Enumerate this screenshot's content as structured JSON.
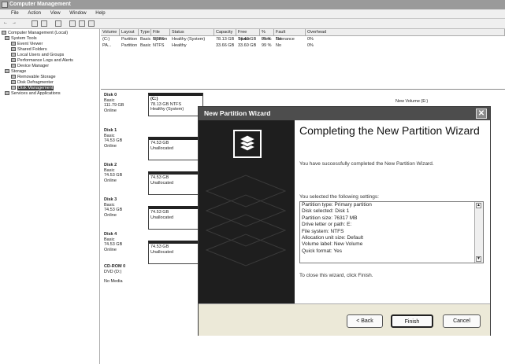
{
  "window": {
    "title": "Computer Management"
  },
  "menu": [
    "File",
    "Action",
    "View",
    "Window",
    "Help"
  ],
  "tree": [
    {
      "label": "Computer Management (Local)",
      "indent": 0
    },
    {
      "label": "System Tools",
      "indent": 1
    },
    {
      "label": "Event Viewer",
      "indent": 2
    },
    {
      "label": "Shared Folders",
      "indent": 2
    },
    {
      "label": "Local Users and Groups",
      "indent": 2
    },
    {
      "label": "Performance Logs and Alerts",
      "indent": 2
    },
    {
      "label": "Device Manager",
      "indent": 2
    },
    {
      "label": "Storage",
      "indent": 1
    },
    {
      "label": "Removable Storage",
      "indent": 2
    },
    {
      "label": "Disk Defragmenter",
      "indent": 2
    },
    {
      "label": "Disk Management",
      "indent": 2,
      "selected": true
    },
    {
      "label": "Services and Applications",
      "indent": 1
    }
  ],
  "volumes": {
    "headers": [
      "Volume",
      "Layout",
      "Type",
      "File System",
      "Status",
      "Capacity",
      "Free Space",
      "% Free",
      "Fault Tolerance",
      "Overhead"
    ],
    "rows": [
      [
        "(C:)",
        "Partition",
        "Basic",
        "NTFS",
        "Healthy (System)",
        "78.13 GB",
        "74.48 GB",
        "95 %",
        "No",
        "0%"
      ],
      [
        "PA...",
        "Partition",
        "Basic",
        "NTFS",
        "Healthy",
        "33.66 GB",
        "33.60 GB",
        "99 %",
        "No",
        "0%"
      ]
    ]
  },
  "disks": [
    {
      "name": "Disk 0",
      "type": "Basic",
      "size": "111.79 GB",
      "status": "Online",
      "part_title": "(C:)",
      "part_line1": "78.13 GB NTFS",
      "part_line2": "Healthy (System)"
    },
    {
      "name": "Disk 1",
      "type": "Basic",
      "size": "74.53 GB",
      "status": "Online",
      "part_title": "",
      "part_line1": "74.53 GB",
      "part_line2": "Unallocated"
    },
    {
      "name": "Disk 2",
      "type": "Basic",
      "size": "74.53 GB",
      "status": "Online",
      "part_title": "",
      "part_line1": "74.53 GB",
      "part_line2": "Unallocated"
    },
    {
      "name": "Disk 3",
      "type": "Basic",
      "size": "74.53 GB",
      "status": "Online",
      "part_title": "",
      "part_line1": "74.53 GB",
      "part_line2": "Unallocated"
    },
    {
      "name": "Disk 4",
      "type": "Basic",
      "size": "74.53 GB",
      "status": "Online",
      "part_title": "",
      "part_line1": "74.53 GB",
      "part_line2": "Unallocated"
    }
  ],
  "cdrom": {
    "name": "CD-ROM 0",
    "type": "DVD (D:)",
    "status": "No Media"
  },
  "disk0_right_label": "New Volume (E:)",
  "wizard": {
    "title": "New Partition Wizard",
    "heading": "Completing the New Partition Wizard",
    "completed_text": "You have successfully completed the New Partition Wizard.",
    "settings_label": "You selected the following settings:",
    "settings": [
      "Partition type: Primary partition",
      "Disk selected: Disk 1",
      "Partition size: 76317 MB",
      "Drive letter or path: E:",
      "File system: NTFS",
      "Allocation unit size: Default",
      "Volume label: New Volume",
      "Quick format: Yes"
    ],
    "close_text": "To close this wizard, click Finish.",
    "back_label": "< Back",
    "finish_label": "Finish",
    "cancel_label": "Cancel"
  },
  "colors": {
    "title_bar": "#4d4d4d",
    "wizard_side": "#1e1e1e",
    "dialog_face": "#ece9d8"
  }
}
